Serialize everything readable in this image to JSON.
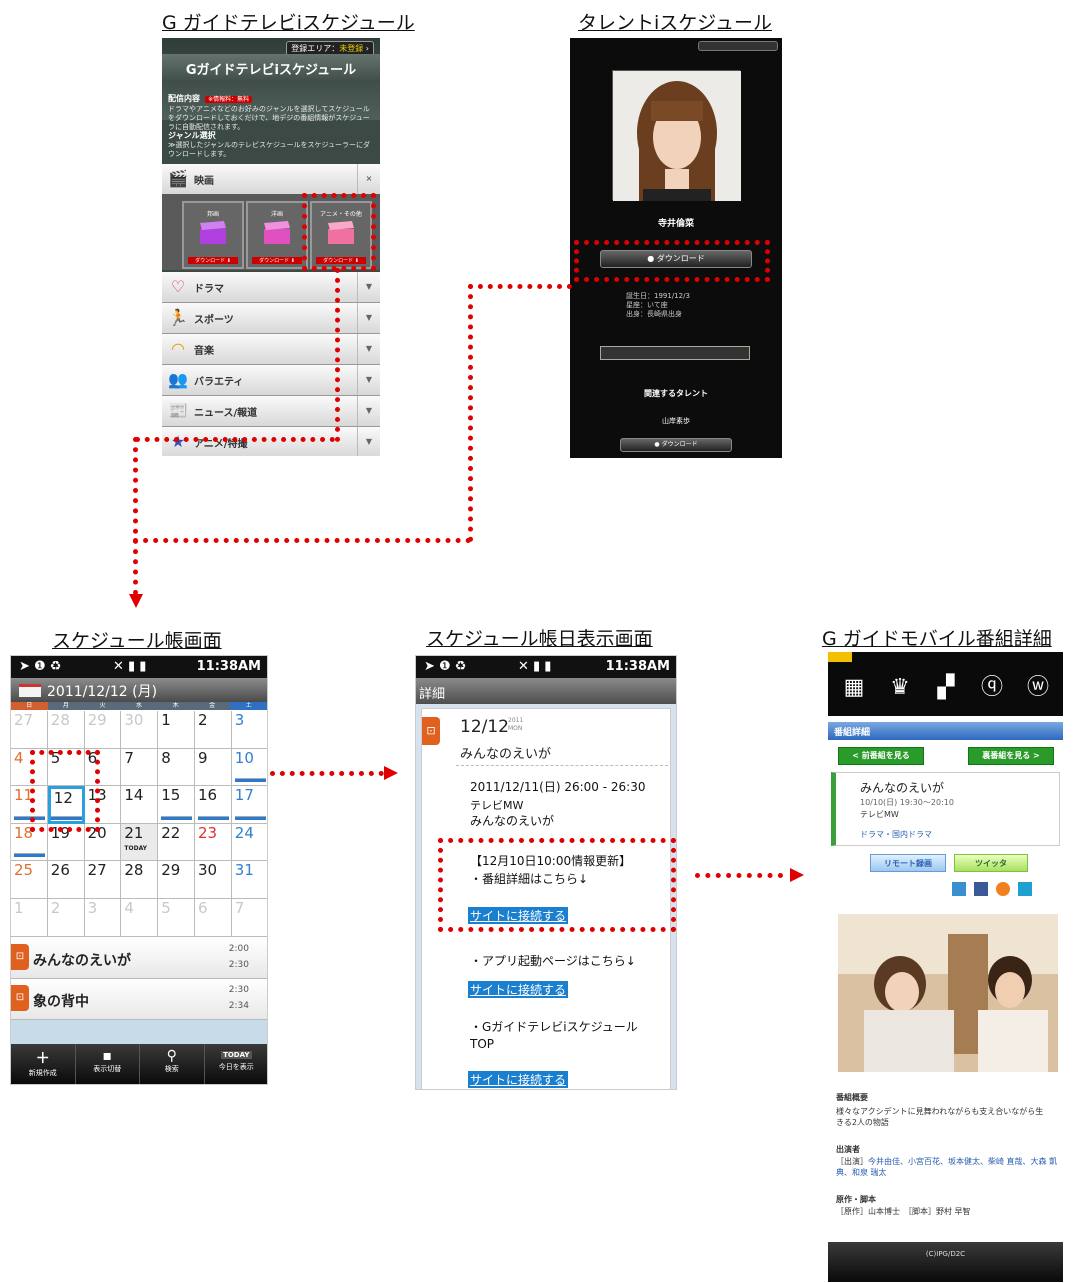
{
  "captions": {
    "s1": "G ガイドテレビiスケジュール",
    "s2": "タレントiスケジュール",
    "s3": "スケジュール帳画面",
    "s4": "スケジュール帳日表示画面",
    "s5": "G ガイドモバイル番組詳細"
  },
  "screen1": {
    "area_label": "登録エリア：",
    "area_value": "未登録",
    "title": "Gガイドテレビiスケジュール",
    "section_delivery": "配信内容",
    "delivery_tag": "※情報料：無料",
    "delivery_text": "ドラマやアニメなどのお好みのジャンルを選択してスケジュールをダウンロードしておくだけで、地デジの番組情報がスケジューラに自動配信されます。",
    "section_genre": "ジャンル選択",
    "genre_text": "≫選択したジャンルのテレビスケジュールをスケジューラーにダウンロードします。",
    "movie_label": "映画",
    "movie_tiles": [
      "邦画",
      "洋画",
      "アニメ・その他"
    ],
    "download_label": "ダウンロード ⬇",
    "categories": [
      "ドラマ",
      "スポーツ",
      "音楽",
      "バラエティ",
      "ニュース/報道",
      "アニメ/特撮"
    ]
  },
  "screen2": {
    "talent_name": "寺井倫菜",
    "download_button": "ダウンロード",
    "info": [
      "誕生日：1991/12/3",
      "星座：いて座",
      "出身：長崎県出身"
    ],
    "related_heading": "関連するタレント",
    "related_name": "山岸素歩"
  },
  "screen3": {
    "status_time": "11:38AM",
    "date_header": "2011/12/12 (月)",
    "weekdays": [
      "日",
      "月",
      "火",
      "水",
      "木",
      "金",
      "土"
    ],
    "weeks": [
      [
        "27",
        "28",
        "29",
        "30",
        "1",
        "2",
        "3"
      ],
      [
        "4",
        "5",
        "6",
        "7",
        "8",
        "9",
        "10"
      ],
      [
        "11",
        "12",
        "13",
        "14",
        "15",
        "16",
        "17"
      ],
      [
        "18",
        "19",
        "20",
        "21",
        "22",
        "23",
        "24"
      ],
      [
        "25",
        "26",
        "27",
        "28",
        "29",
        "30",
        "31"
      ],
      [
        "1",
        "2",
        "3",
        "4",
        "5",
        "6",
        "7"
      ]
    ],
    "today_label": "TODAY",
    "events": [
      {
        "title": "みんなのえいが",
        "start": "2:00",
        "end": "2:30"
      },
      {
        "title": "象の背中",
        "start": "2:30",
        "end": "2:34"
      }
    ],
    "toolbar": [
      "新規作成",
      "表示切替",
      "検索",
      "今日を表示"
    ],
    "toolbar_today_icon": "TODAY"
  },
  "screen4": {
    "status_time": "11:38AM",
    "header": "詳細",
    "date": "12/12",
    "year": "2011",
    "dow": "MON",
    "program": "みんなのえいが",
    "datetime": "2011/12/11(日) 26:00 - 26:30",
    "channel": "テレビMW",
    "program2": "みんなのえいが",
    "update": "【12月10日10:00情報更新】",
    "detail_link_text": "・番組詳細はこちら↓",
    "link_label": "サイトに接続する",
    "app_link_text": "・アプリ起動ページはこちら↓",
    "top_link_text": "・GガイドテレビiスケジュールTOP"
  },
  "screen5": {
    "header": "番組詳細",
    "prev_btn": "< 前番組を見る",
    "next_btn": "裏番組を見る >",
    "program": "みんなのえいが",
    "time": "10/10(日) 19:30～20:10",
    "channel": "テレビMW",
    "genre": "ドラマ・国内ドラマ",
    "remote_btn": "リモート録画",
    "tweet_btn": "ツイッタ",
    "synopsis_head": "番組概要",
    "synopsis": "様々なアクシデントに見舞われながらも支え合いながら生きる2人の物語",
    "cast_head": "出演者",
    "cast_label": "［出演］",
    "cast": "今井由佳、小宮百花、坂本健太、柴崎 直哉、大森 凱典、和泉 瑞太",
    "orig_head": "原作・脚本",
    "orig": "［原作］山本博士　［脚本］野村 早智",
    "footer": "(C)IPG/D2C"
  }
}
